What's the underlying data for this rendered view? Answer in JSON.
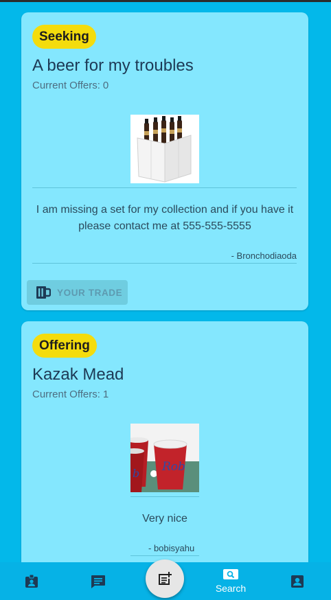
{
  "listings": [
    {
      "badge": "Seeking",
      "title": "A beer for my troubles",
      "offers_label": "Current Offers:",
      "offers_count": "0",
      "description": "I am missing a set for my collection and if you have it please contact me at 555-555-5555",
      "author": "- Bronchodiaoda",
      "trade_button": "YOUR TRADE",
      "image": "six-pack-beer-bottles"
    },
    {
      "badge": "Offering",
      "title": "Kazak Mead",
      "offers_label": "Current Offers:",
      "offers_count": "1",
      "description": "Very nice",
      "author": "- bobisyahu",
      "image": "red-cups-beer-pong",
      "cup_text": "Rob"
    }
  ],
  "nav": {
    "items": [
      {
        "name": "badge-icon",
        "label": ""
      },
      {
        "name": "chat-icon",
        "label": ""
      },
      {
        "name": "new-post-icon",
        "label": ""
      },
      {
        "name": "search-icon",
        "label": "Search",
        "active": true
      },
      {
        "name": "profile-icon",
        "label": ""
      }
    ]
  },
  "colors": {
    "background": "#03b8ea",
    "card": "#84e7fe",
    "badge": "#f4dc0c",
    "navbar": "#06b2e6"
  }
}
